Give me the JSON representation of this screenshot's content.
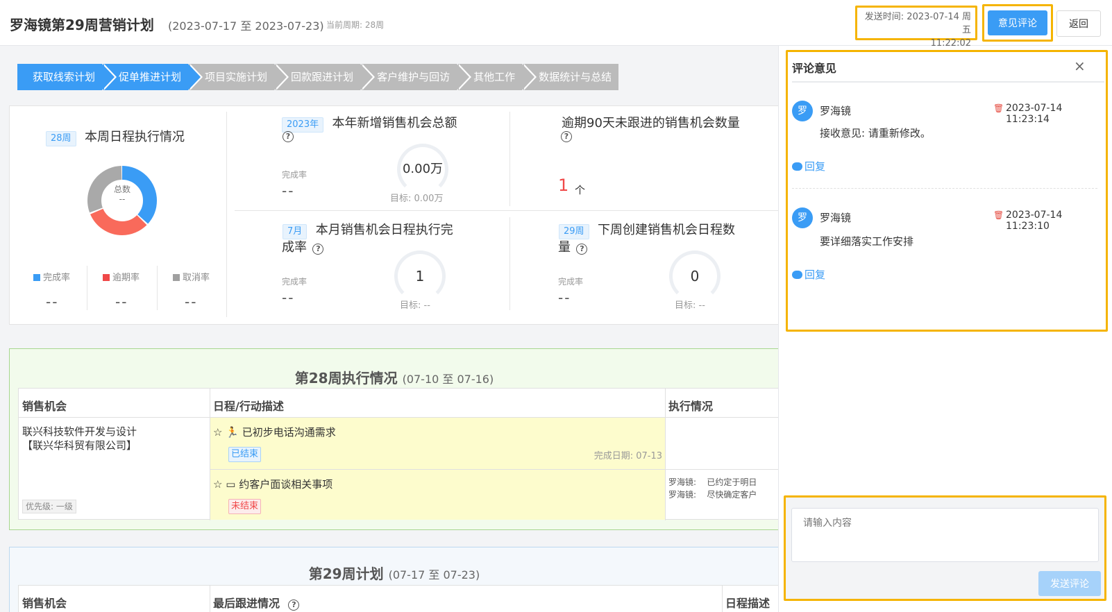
{
  "header": {
    "title": "罗海镜第29周营销计划",
    "range": "(2023-07-17 至 2023-07-23)",
    "current_period": "当前周期: 28周",
    "send_time_line1": "发送时间: 2023-07-14 周五",
    "send_time_line2": "11:22:02",
    "comment_button": "意见评论",
    "back_button": "返回"
  },
  "steps": [
    {
      "label": "获取线索计划",
      "active": true
    },
    {
      "label": "促单推进计划",
      "active": true
    },
    {
      "label": "项目实施计划",
      "active": false
    },
    {
      "label": "回款跟进计划",
      "active": false
    },
    {
      "label": "客户维护与回访",
      "active": false
    },
    {
      "label": "其他工作",
      "active": false
    },
    {
      "label": "数据统计与总结",
      "active": false
    }
  ],
  "stats": {
    "weekly": {
      "tag": "28周",
      "title": "本周日程执行情况",
      "donut_center_label": "总数",
      "donut_center_value": "--",
      "legend": [
        {
          "label": "完成率",
          "color": "#3a9cf5",
          "value": "--"
        },
        {
          "label": "逾期率",
          "color": "#f04848",
          "value": "--"
        },
        {
          "label": "取消率",
          "color": "#a0a0a0",
          "value": "--"
        }
      ]
    },
    "yearly_new": {
      "tag": "2023年",
      "title": "本年新增销售机会总额",
      "help": "?",
      "rate_label": "完成率",
      "rate_value": "--",
      "gauge_value": "0.00万",
      "target": "目标: 0.00万"
    },
    "overdue": {
      "title": "逾期90天未跟进的销售机会数量",
      "help": "?",
      "value": "1",
      "unit": "个"
    },
    "monthly": {
      "tag": "7月",
      "title_line1": "本月销售机会日程执行完",
      "title_line2": "成率",
      "help": "?",
      "rate_label": "完成率",
      "rate_value": "--",
      "gauge_value": "1",
      "target": "目标: --"
    },
    "next_week": {
      "tag": "29周",
      "title_line1": "下周创建销售机会日程数",
      "title_line2": "量",
      "help": "?",
      "rate_label": "完成率",
      "rate_value": "--",
      "gauge_value": "0",
      "target": "目标: --"
    }
  },
  "week28": {
    "title": "第28周执行情况",
    "subtitle": "(07-10 至 07-16)",
    "headers": [
      "销售机会",
      "日程/行动描述",
      "执行情况"
    ],
    "opportunity_line1": "联兴科技软件开发与设计",
    "opportunity_line2": "【联兴华科贸有限公司】",
    "priority": "优先级: 一级",
    "actions": [
      {
        "text": "已初步电话沟通需求",
        "status": "已结束",
        "date": "完成日期: 07-13"
      },
      {
        "text": "约客户面谈相关事项",
        "status": "未结束",
        "date": ""
      }
    ],
    "execution": [
      {
        "who": "罗海镜:",
        "text": "已约定于明日"
      },
      {
        "who": "罗海镜:",
        "text": "尽快确定客户"
      }
    ]
  },
  "week29": {
    "title": "第29周计划",
    "subtitle": "(07-17 至 07-23)",
    "headers": [
      "销售机会",
      "最后跟进情况",
      "日程描述"
    ]
  },
  "comments": {
    "title": "评论意见",
    "close": "×",
    "items": [
      {
        "avatar": "罗",
        "name": "罗海镜",
        "time": "2023-07-14 11:23:14",
        "text": "接收意见: 请重新修改。",
        "reply": "回复"
      },
      {
        "avatar": "罗",
        "name": "罗海镜",
        "time": "2023-07-14 11:23:10",
        "text": "要详细落实工作安排",
        "reply": "回复"
      }
    ],
    "input_placeholder": "请输入内容",
    "send_button": "发送评论"
  }
}
